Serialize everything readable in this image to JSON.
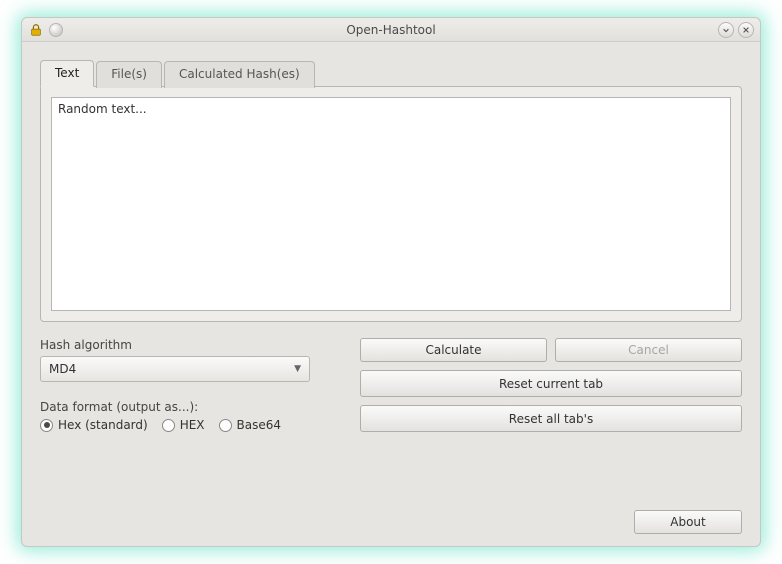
{
  "window": {
    "title": "Open-Hashtool"
  },
  "tabs": {
    "text": "Text",
    "files": "File(s)",
    "calculated": "Calculated Hash(es)"
  },
  "textarea": {
    "value": "Random text..."
  },
  "hash": {
    "label": "Hash algorithm",
    "selected": "MD4"
  },
  "format": {
    "label": "Data format (output as...):",
    "hex_std": "Hex (standard)",
    "hex_upper": "HEX",
    "base64": "Base64"
  },
  "buttons": {
    "calculate": "Calculate",
    "cancel": "Cancel",
    "reset_current": "Reset current tab",
    "reset_all": "Reset all tab's",
    "about": "About"
  }
}
